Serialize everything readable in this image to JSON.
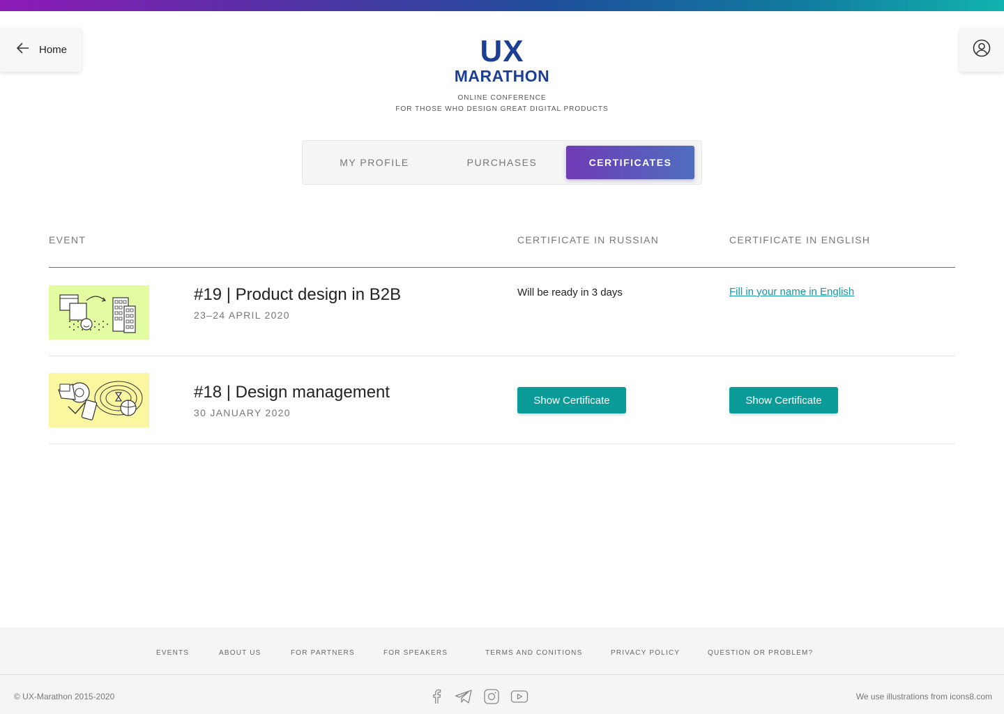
{
  "nav": {
    "home_label": "Home",
    "home_icon": "arrow-left-icon",
    "profile_icon": "user-circle-icon"
  },
  "logo": {
    "line1": "UX",
    "line2": "MARATHON",
    "color": "#1c3f94"
  },
  "tagline": {
    "line1": "ONLINE CONFERENCE",
    "line2": "FOR THOSE WHO DESIGN GREAT DIGITAL PRODUCTS"
  },
  "tabs": [
    {
      "label": "MY PROFILE",
      "active": false
    },
    {
      "label": "PURCHASES",
      "active": false
    },
    {
      "label": "CERTIFICATES",
      "active": true
    }
  ],
  "table": {
    "headers": [
      "EVENT",
      "CERTIFICATE IN RUSSIAN",
      "CERTIFICATE IN ENGLISH"
    ],
    "rows": [
      {
        "title": "#19 | Product design in B2B",
        "date": "23–24 APRIL 2020",
        "thumb_color": "#e3fca1",
        "russian": "Will be ready in 3 days",
        "english": "Fill in your name in English"
      },
      {
        "title": "#18 | Design management",
        "date": "30 JANUARY 2020",
        "thumb_color": "#fbf6a0",
        "russian": "Show Certificate",
        "english": "Show Certificate"
      }
    ]
  },
  "footer": {
    "links": [
      "EVENTS",
      "ABOUT US",
      "FOR PARTNERS",
      "FOR SPEAKERS",
      "TERMS AND CONITIONS",
      "PRIVACY POLICY",
      "QUESTION OR PROBLEM?"
    ],
    "copyright": "© UX-Marathon 2015-2020",
    "credits": "We use illustrations from icons8.com",
    "social_icons": [
      "facebook-icon",
      "telegram-icon",
      "instagram-icon",
      "youtube-icon"
    ]
  },
  "colors": {
    "accent": "#0b9b99",
    "link": "#139aa6",
    "tab_active_start": "#6f3bb5",
    "tab_active_end": "#4f6ec0"
  }
}
